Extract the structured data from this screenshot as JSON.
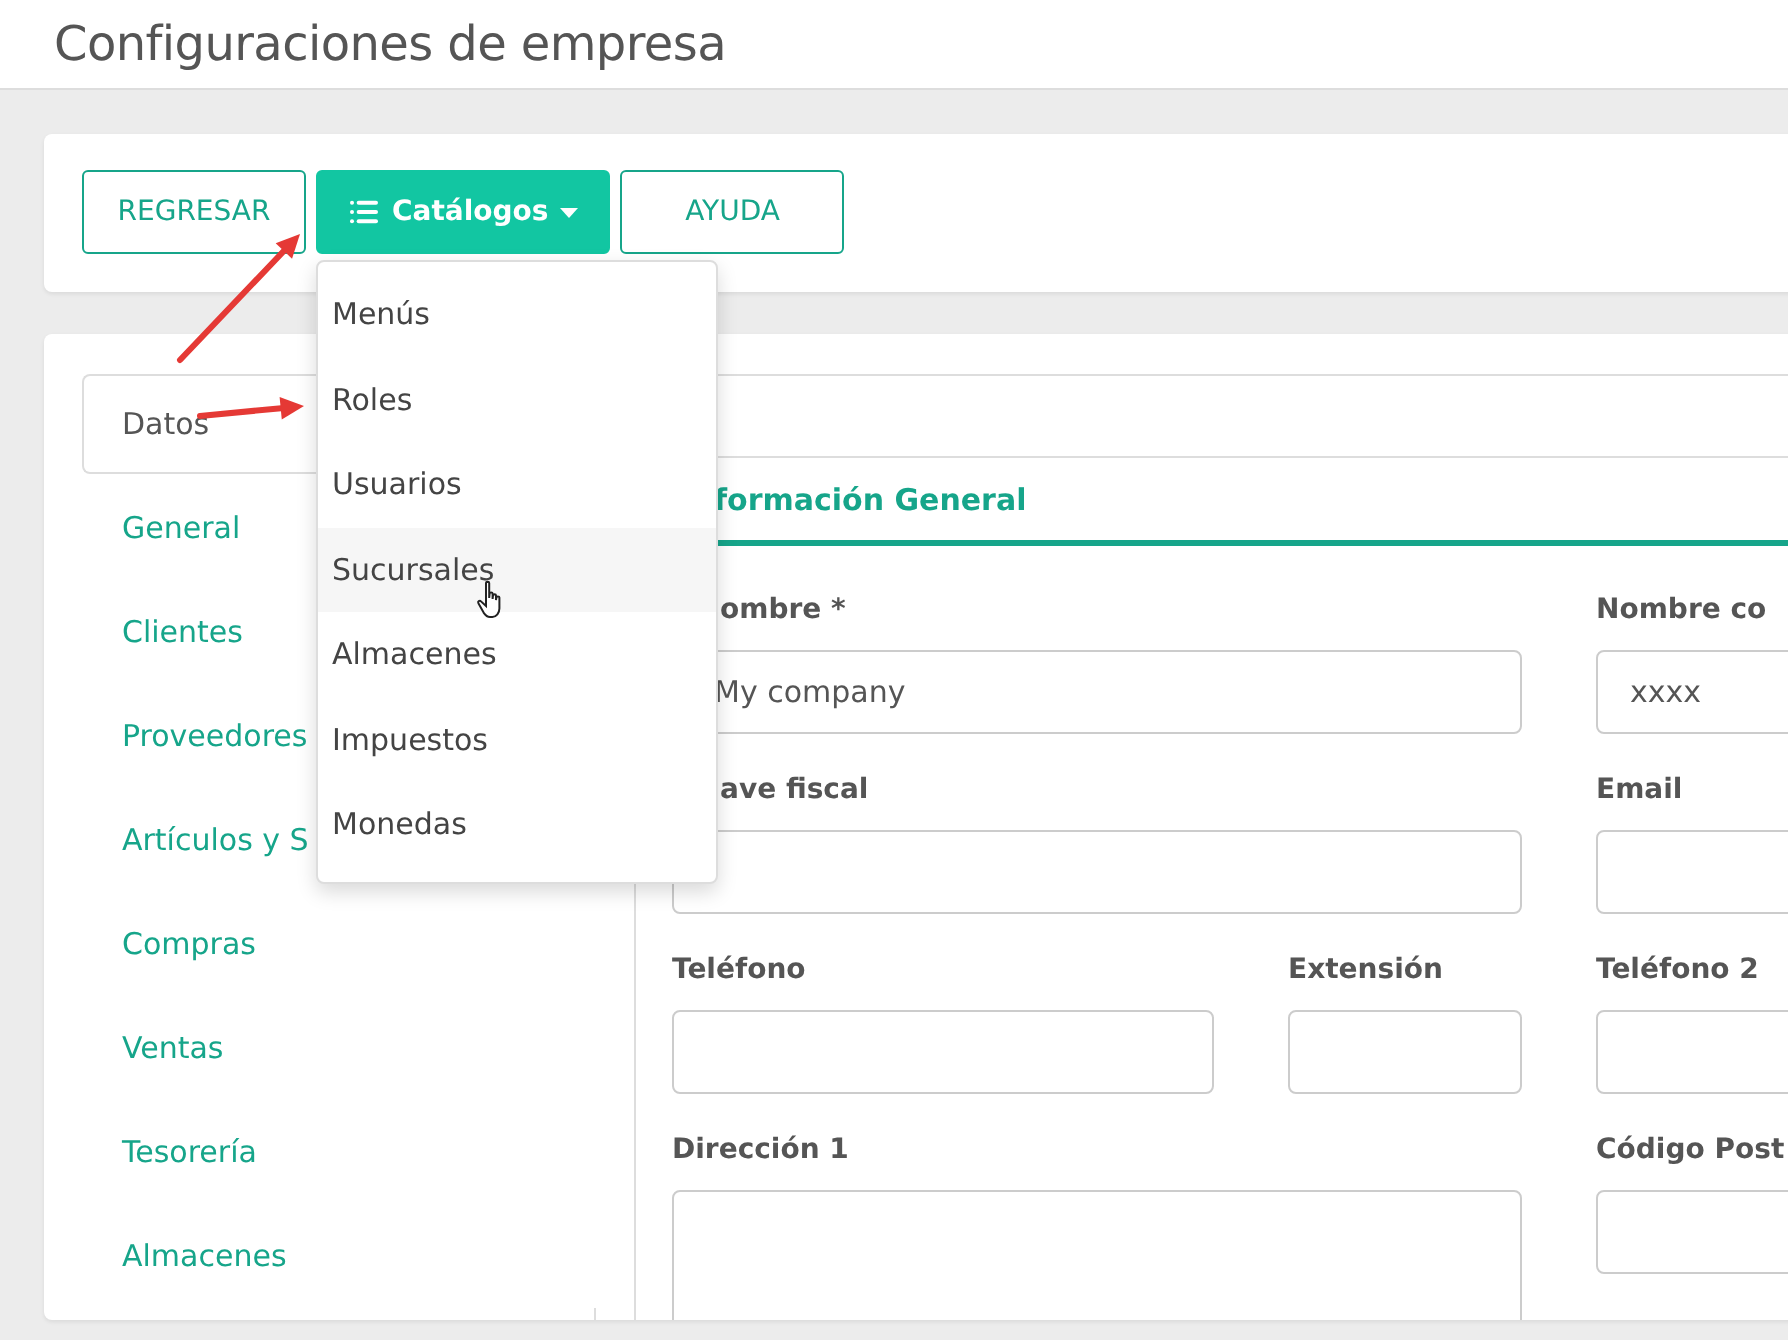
{
  "page": {
    "title": "Configuraciones de empresa"
  },
  "toolbar": {
    "buttons": [
      {
        "label": "REGRESAR",
        "kind": "outline"
      },
      {
        "label": "Catálogos",
        "kind": "dropdown"
      },
      {
        "label": "AYUDA",
        "kind": "outline"
      }
    ]
  },
  "catalog_menu": {
    "open": true,
    "items": [
      {
        "label": "Menús",
        "highlighted": false
      },
      {
        "label": "Roles",
        "highlighted": false
      },
      {
        "label": "Usuarios",
        "highlighted": false
      },
      {
        "label": "Sucursales",
        "highlighted": true
      },
      {
        "label": "Almacenes",
        "highlighted": false
      },
      {
        "label": "Impuestos",
        "highlighted": false
      },
      {
        "label": "Monedas",
        "highlighted": false
      }
    ]
  },
  "sidebar": {
    "items": [
      {
        "label": "Datos",
        "selected": true
      },
      {
        "label": "General",
        "selected": false
      },
      {
        "label": "Clientes",
        "selected": false
      },
      {
        "label": "Proveedores",
        "selected": false
      },
      {
        "label": "Artículos y S",
        "selected": false
      },
      {
        "label": "Compras",
        "selected": false
      },
      {
        "label": "Ventas",
        "selected": false
      },
      {
        "label": "Tesorería",
        "selected": false
      },
      {
        "label": "Almacenes",
        "selected": false
      }
    ]
  },
  "form": {
    "tab": "formación General",
    "rows": [
      {
        "fields": [
          {
            "label": "ombre *",
            "value": "My company",
            "kind": "wide"
          },
          {
            "label": "Nombre co",
            "value": "xxxx",
            "kind": "input"
          }
        ]
      },
      {
        "fields": [
          {
            "label": "ave fiscal",
            "kind": "wide"
          },
          {
            "label": "Email",
            "kind": "input"
          }
        ]
      },
      {
        "fields": [
          {
            "label": "Teléfono",
            "kind": "input"
          },
          {
            "label": "Extensión",
            "kind": "input"
          },
          {
            "label": "Teléfono 2",
            "kind": "input"
          }
        ]
      },
      {
        "fields": [
          {
            "label": "Dirección 1",
            "kind": "textarea"
          },
          {
            "label": "Código Post",
            "kind": "input"
          }
        ]
      }
    ]
  }
}
